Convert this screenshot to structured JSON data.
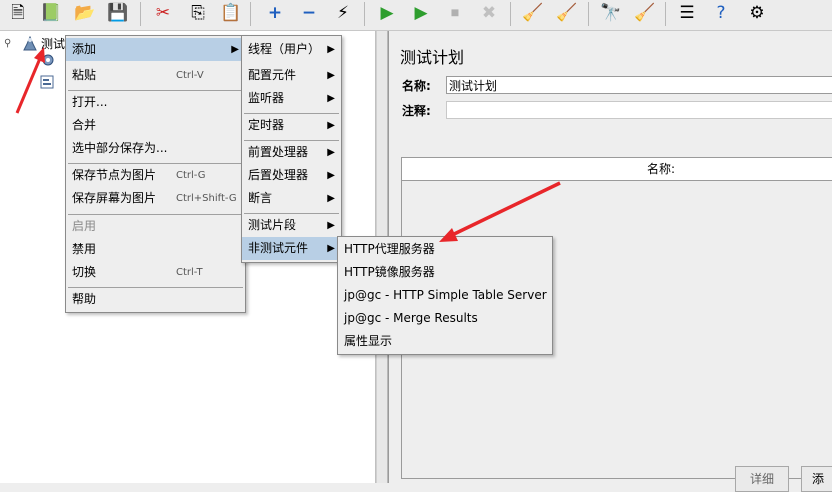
{
  "toolbar": {
    "buttons": [
      {
        "name": "new-icon",
        "glyph": "🗎"
      },
      {
        "name": "templates-icon",
        "glyph": "📗"
      },
      {
        "name": "open-icon",
        "glyph": "📂"
      },
      {
        "name": "save-icon",
        "glyph": "💾"
      },
      {
        "name": "cut-icon",
        "glyph": "✂"
      },
      {
        "name": "copy-icon",
        "glyph": "⎘"
      },
      {
        "name": "paste-icon",
        "glyph": "📋"
      },
      {
        "name": "expand-icon",
        "glyph": "+"
      },
      {
        "name": "collapse-icon",
        "glyph": "−"
      },
      {
        "name": "toggle-icon",
        "glyph": "⚡"
      },
      {
        "name": "start-icon",
        "glyph": "▶"
      },
      {
        "name": "start-no-pauses-icon",
        "glyph": "▶"
      },
      {
        "name": "stop-icon",
        "glyph": "⏹"
      },
      {
        "name": "shutdown-icon",
        "glyph": "✖"
      },
      {
        "name": "clear-icon",
        "glyph": "🧹"
      },
      {
        "name": "clear-all-icon",
        "glyph": "🧹"
      },
      {
        "name": "search-icon",
        "glyph": "🔭"
      },
      {
        "name": "reset-search-icon",
        "glyph": "🧹"
      },
      {
        "name": "function-helper-icon",
        "glyph": "☰"
      },
      {
        "name": "help-icon",
        "glyph": "?"
      },
      {
        "name": "remote-icon",
        "glyph": "⚙"
      }
    ]
  },
  "tree": {
    "root_label": "测试",
    "root_icon": "test-plan-icon",
    "child_icons": [
      "workbench-icon",
      "workbench-item-icon"
    ]
  },
  "right_panel": {
    "title": "测试计划",
    "name_label": "名称:",
    "name_value": "测试计划",
    "comment_label": "注释:",
    "comment_value": "",
    "table_header": "名称:",
    "buttons": [
      "详细",
      "添"
    ]
  },
  "menu1": {
    "items": [
      {
        "label": "添加",
        "shortcut": "",
        "submenu": true,
        "highlight": true,
        "disabled": false
      },
      {
        "label": "粘贴",
        "shortcut": "Ctrl-V",
        "submenu": false,
        "highlight": false,
        "disabled": false
      },
      {
        "label": "打开...",
        "shortcut": "",
        "submenu": false,
        "highlight": false,
        "disabled": false
      },
      {
        "label": "合并",
        "shortcut": "",
        "submenu": false,
        "highlight": false,
        "disabled": false
      },
      {
        "label": "选中部分保存为...",
        "shortcut": "",
        "submenu": false,
        "highlight": false,
        "disabled": false
      },
      {
        "label": "保存节点为图片",
        "shortcut": "Ctrl-G",
        "submenu": false,
        "highlight": false,
        "disabled": false
      },
      {
        "label": "保存屏幕为图片",
        "shortcut": "Ctrl+Shift-G",
        "submenu": false,
        "highlight": false,
        "disabled": false
      },
      {
        "label": "启用",
        "shortcut": "",
        "submenu": false,
        "highlight": false,
        "disabled": true
      },
      {
        "label": "禁用",
        "shortcut": "",
        "submenu": false,
        "highlight": false,
        "disabled": false
      },
      {
        "label": "切换",
        "shortcut": "Ctrl-T",
        "submenu": false,
        "highlight": false,
        "disabled": false
      },
      {
        "label": "帮助",
        "shortcut": "",
        "submenu": false,
        "highlight": false,
        "disabled": false
      }
    ]
  },
  "menu2": {
    "items": [
      {
        "label": "线程（用户）",
        "submenu": true,
        "highlight": false
      },
      {
        "label": "配置元件",
        "submenu": true,
        "highlight": false
      },
      {
        "label": "监听器",
        "submenu": true,
        "highlight": false
      },
      {
        "label": "定时器",
        "submenu": true,
        "highlight": false
      },
      {
        "label": "前置处理器",
        "submenu": true,
        "highlight": false
      },
      {
        "label": "后置处理器",
        "submenu": true,
        "highlight": false
      },
      {
        "label": "断言",
        "submenu": true,
        "highlight": false
      },
      {
        "label": "测试片段",
        "submenu": true,
        "highlight": false
      },
      {
        "label": "非测试元件",
        "submenu": true,
        "highlight": true
      }
    ]
  },
  "menu3": {
    "items": [
      {
        "label": "HTTP代理服务器"
      },
      {
        "label": "HTTP镜像服务器"
      },
      {
        "label": "jp@gc - HTTP Simple Table Server"
      },
      {
        "label": "jp@gc - Merge Results"
      },
      {
        "label": "属性显示"
      }
    ]
  },
  "colors": {
    "highlight": "#b8cfe5",
    "annotation_arrow": "#e8262a",
    "run_green": "#2e9e2e"
  }
}
